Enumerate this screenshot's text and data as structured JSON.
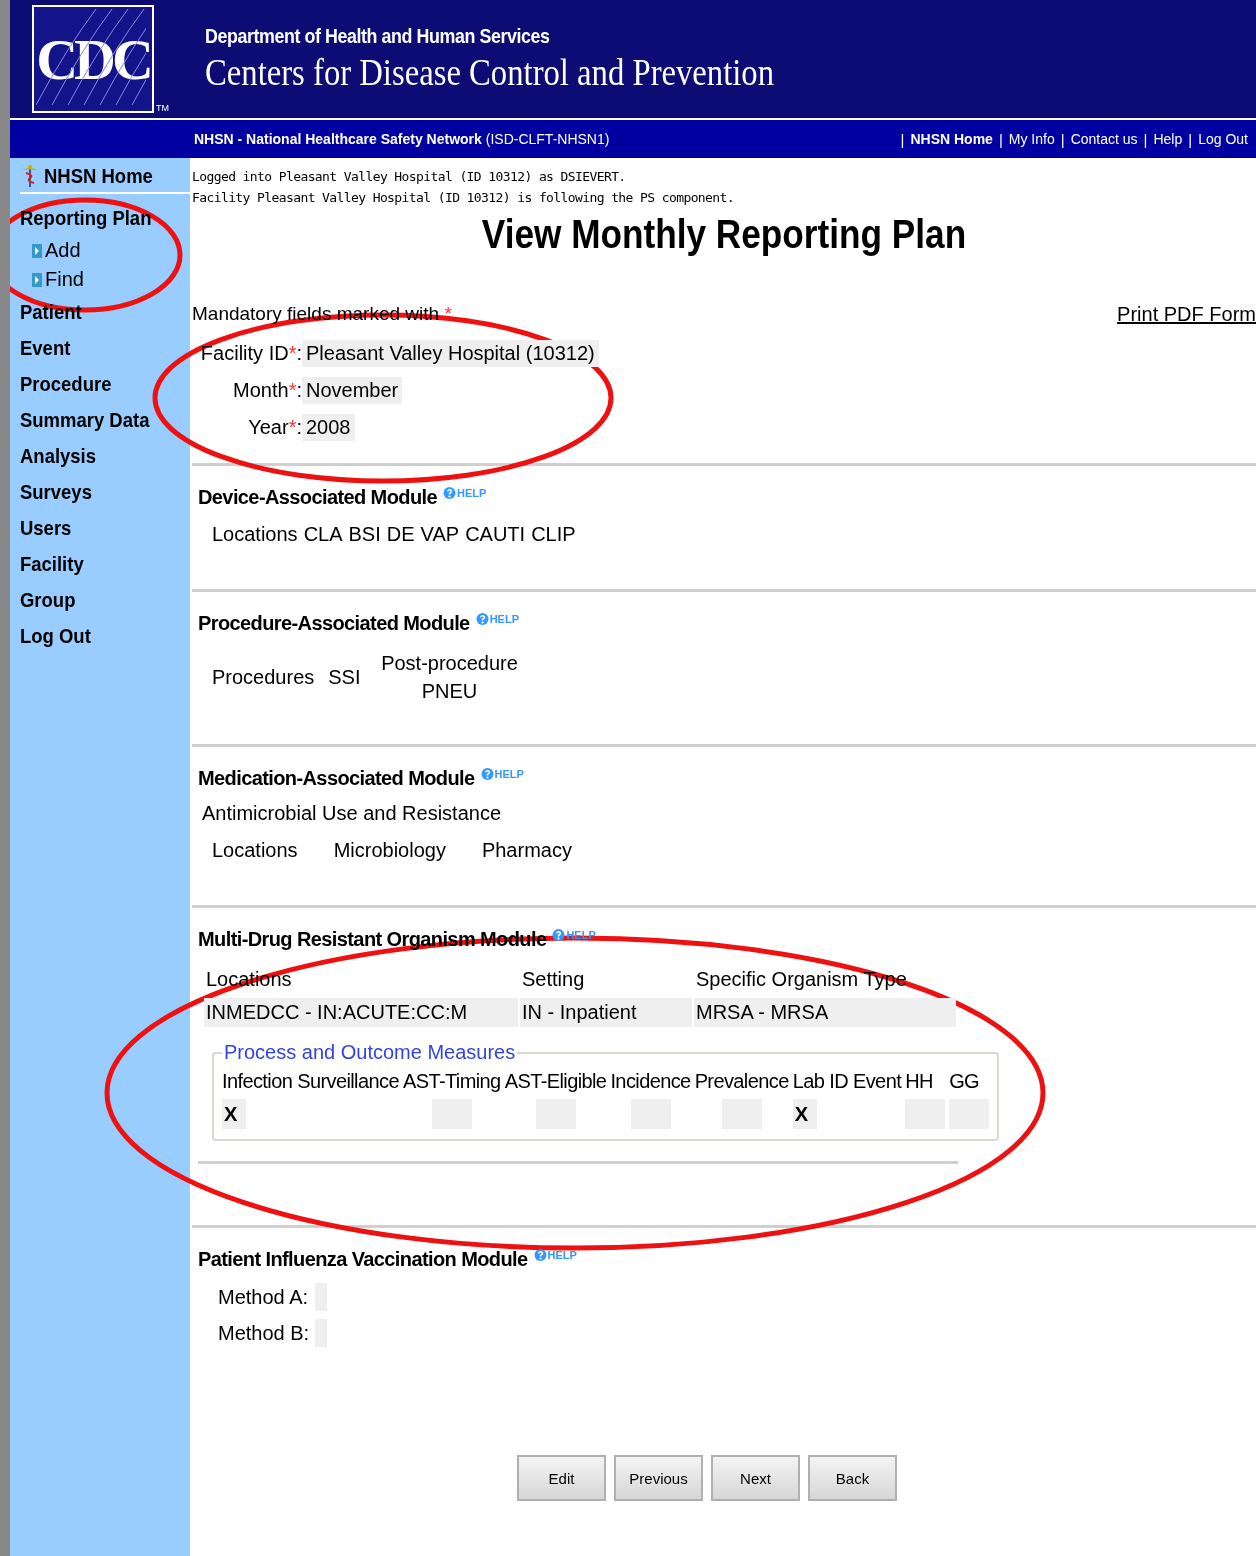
{
  "header": {
    "logo": "CDC",
    "trademark": "TM",
    "department": "Department of Health and Human Services",
    "agency": "Centers for Disease Control and Prevention"
  },
  "nav_bar": {
    "app_name": "NHSN - National Healthcare Safety Network",
    "app_id": "(ISD-CLFT-NHSN1)",
    "links": [
      {
        "divider": "|",
        "label": "NHSN Home",
        "bold": true
      },
      {
        "divider": "|",
        "label": "My Info",
        "bold": false
      },
      {
        "divider": "|",
        "label": "Contact us",
        "bold": false
      },
      {
        "divider": "|",
        "label": "Help",
        "bold": false
      },
      {
        "divider": "|",
        "label": "Log Out",
        "bold": false
      }
    ]
  },
  "sidebar": {
    "home": "NHSN Home",
    "items": [
      {
        "label": "Reporting Plan",
        "children": [
          {
            "label": "Add"
          },
          {
            "label": "Find"
          }
        ]
      },
      {
        "label": "Patient"
      },
      {
        "label": "Event"
      },
      {
        "label": "Procedure"
      },
      {
        "label": "Summary Data"
      },
      {
        "label": "Analysis"
      },
      {
        "label": "Surveys"
      },
      {
        "label": "Users"
      },
      {
        "label": "Facility"
      },
      {
        "label": "Group"
      },
      {
        "label": "Log Out"
      }
    ]
  },
  "login_info": [
    "Logged into Pleasant Valley Hospital (ID 10312) as DSIEVERT.",
    "Facility Pleasant Valley Hospital (ID 10312) is following the PS component."
  ],
  "page_title": "View Monthly Reporting Plan",
  "mandatory_note": "Mandatory fields marked with",
  "required_mark": "*",
  "print_link": "Print PDF Form",
  "fields": [
    {
      "label": "Facility ID",
      "colon": ":",
      "value": "Pleasant Valley Hospital (10312)"
    },
    {
      "label": "Month",
      "colon": ":",
      "value": "November"
    },
    {
      "label": "Year",
      "colon": ":",
      "value": "2008"
    }
  ],
  "device_module": {
    "title": "Device-Associated Module",
    "help": "HELP",
    "columns": [
      "Locations",
      "CLA",
      "BSI",
      "DE",
      "VAP",
      "CAUTI",
      "CLIP"
    ]
  },
  "procedure_module": {
    "title": "Procedure-Associated Module",
    "help": "HELP",
    "columns": [
      "Procedures",
      "SSI",
      "Post-procedure PNEU"
    ]
  },
  "medication_module": {
    "title": "Medication-Associated Module",
    "help": "HELP",
    "subtitle": "Antimicrobial Use and Resistance",
    "columns": [
      "Locations",
      "Microbiology",
      "Pharmacy"
    ]
  },
  "mdro_module": {
    "title": "Multi-Drug Resistant Organism Module",
    "help": "HELP",
    "columns": [
      "Locations",
      "Setting",
      "Specific Organism Type"
    ],
    "row": [
      "INMEDCC - IN:ACUTE:CC:M",
      "IN - Inpatient",
      "MRSA - MRSA"
    ],
    "measures_title": "Process and Outcome Measures",
    "measures": [
      {
        "label": "Infection Surveillance",
        "value": "X"
      },
      {
        "label": "AST-Timing"
      },
      {
        "label": "AST-Eligible"
      },
      {
        "label": "Incidence"
      },
      {
        "label": "Prevalence"
      },
      {
        "label": "Lab ID Event",
        "value": "X"
      },
      {
        "label": "HH"
      },
      {
        "label": "GG"
      }
    ]
  },
  "influenza_module": {
    "title": "Patient Influenza Vaccination Module",
    "help": "HELP",
    "fields": [
      {
        "label": "Method A:"
      },
      {
        "label": "Method B:"
      }
    ]
  },
  "buttons": [
    "Edit",
    "Previous",
    "Next",
    "Back"
  ],
  "annotations": [
    {
      "kind": "ellipse"
    },
    {
      "kind": "ellipse"
    },
    {
      "kind": "ellipse"
    }
  ]
}
